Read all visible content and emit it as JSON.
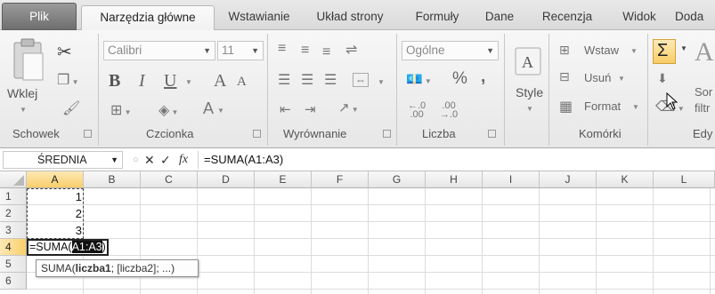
{
  "tabs": [
    {
      "label": "Plik"
    },
    {
      "label": "Narzędzia główne"
    },
    {
      "label": "Wstawianie"
    },
    {
      "label": "Układ strony"
    },
    {
      "label": "Formuły"
    },
    {
      "label": "Dane"
    },
    {
      "label": "Recenzja"
    },
    {
      "label": "Widok"
    },
    {
      "label": "Doda"
    }
  ],
  "ribbon": {
    "clipboard": {
      "label": "Schowek",
      "paste": "Wklej"
    },
    "font": {
      "label": "Czcionka",
      "name": "Calibri",
      "size": "11",
      "bold": "B",
      "italic": "I",
      "underline": "U",
      "grow": "A",
      "shrink": "A",
      "color": "A"
    },
    "alignment": {
      "label": "Wyrównanie"
    },
    "number": {
      "label": "Liczba",
      "format": "Ogólne",
      "percent": "%",
      "comma": ","
    },
    "styles": {
      "label": "Style"
    },
    "cells": {
      "label": "Komórki",
      "insert": "Wstaw",
      "delete": "Usuń",
      "format": "Format"
    },
    "editing": {
      "label": "Edy",
      "sort_line1": "Sor",
      "sort_line2": "filtr"
    }
  },
  "formula_bar": {
    "name_box": "ŚREDNIA",
    "cancel": "✕",
    "enter": "✓",
    "fx": "fx",
    "formula": "=SUMA(A1:A3)"
  },
  "grid": {
    "columns": [
      "A",
      "B",
      "C",
      "D",
      "E",
      "F",
      "G",
      "H",
      "I",
      "J",
      "K",
      "L"
    ],
    "rows": [
      "1",
      "2",
      "3",
      "4",
      "5",
      "6"
    ],
    "values": {
      "A1": "1",
      "A2": "2",
      "A3": "3"
    },
    "edit_prefix": "=SUMA(",
    "edit_ref": "A1:A3",
    "edit_suffix": ")",
    "tooltip_fn": "SUMA(",
    "tooltip_arg1": "liczba1",
    "tooltip_rest": "; [liczba2]; ...)"
  }
}
